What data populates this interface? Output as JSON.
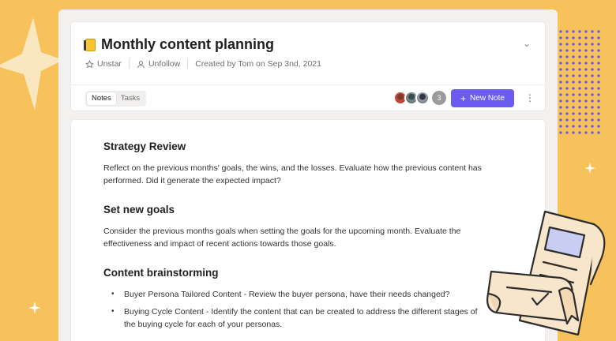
{
  "header": {
    "title": "Monthly content planning",
    "star_label": "Unstar",
    "follow_label": "Unfollow",
    "created_by": "Created by Tom on Sep 3nd, 2021"
  },
  "tabs": [
    {
      "label": "Notes",
      "active": true
    },
    {
      "label": "Tasks",
      "active": false
    }
  ],
  "collaborators": {
    "extra_count": "3"
  },
  "actions": {
    "new_note_label": "New Note",
    "new_note_icon": "+"
  },
  "document": {
    "sections": [
      {
        "heading": "Strategy Review",
        "body": "Reflect on the previous months' goals, the wins, and the losses. Evaluate how the previous content has performed. Did it generate the expected impact?"
      },
      {
        "heading": "Set new goals",
        "body": "Consider the previous months goals when setting the goals for the upcoming month. Evaluate the effectiveness and impact of recent actions towards those goals."
      },
      {
        "heading": "Content brainstorming",
        "bullets": [
          "Buyer Persona Tailored Content - Review the buyer persona, have their needs changed?",
          "Buying Cycle Content - Identify the content that can be created to address the different stages of the buying cycle for each of your personas."
        ]
      }
    ]
  },
  "colors": {
    "background": "#f7c25c",
    "accent": "#6b5bf0",
    "dots": "#6a58e6"
  }
}
